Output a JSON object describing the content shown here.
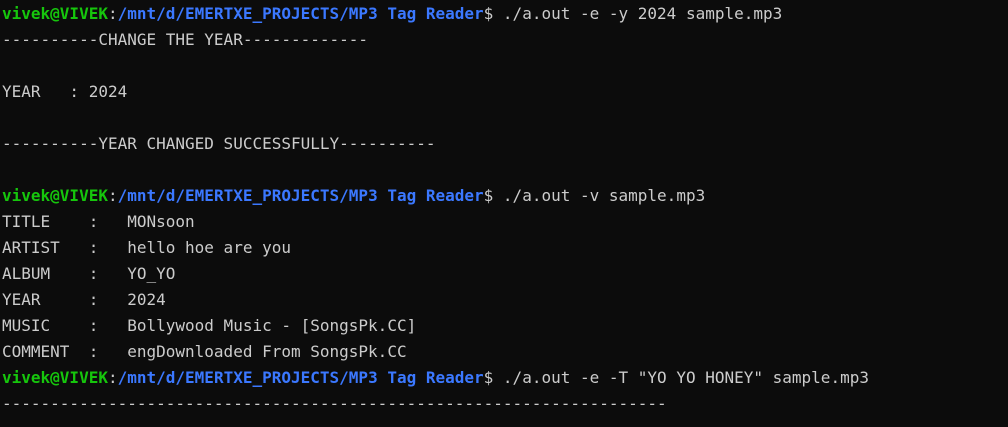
{
  "prompt": {
    "user_host": "vivek@VIVEK",
    "separator": ":",
    "path": "/mnt/d/EMERTXE_PROJECTS/MP3 Tag Reader",
    "symbol": "$ "
  },
  "commands": {
    "change_year": "./a.out -e -y 2024 sample.mp3",
    "view": "./a.out -v sample.mp3",
    "change_title": "./a.out -e -T \"YO YO HONEY\" sample.mp3"
  },
  "output": {
    "change_year_header": "----------CHANGE THE YEAR-------------",
    "year_line": "YEAR   : 2024",
    "year_success": "----------YEAR CHANGED SUCCESSFULLY----------",
    "tags": [
      "TITLE    :   MONsoon",
      "ARTIST   :   hello hoe are you",
      "ALBUM    :   YO_YO",
      "YEAR     :   2024",
      "MUSIC    :   Bollywood Music - [SongsPk.CC]",
      "COMMENT  :   engDownloaded From SongsPk.CC"
    ],
    "last_rule": "---------------------------------------------------------------------"
  }
}
